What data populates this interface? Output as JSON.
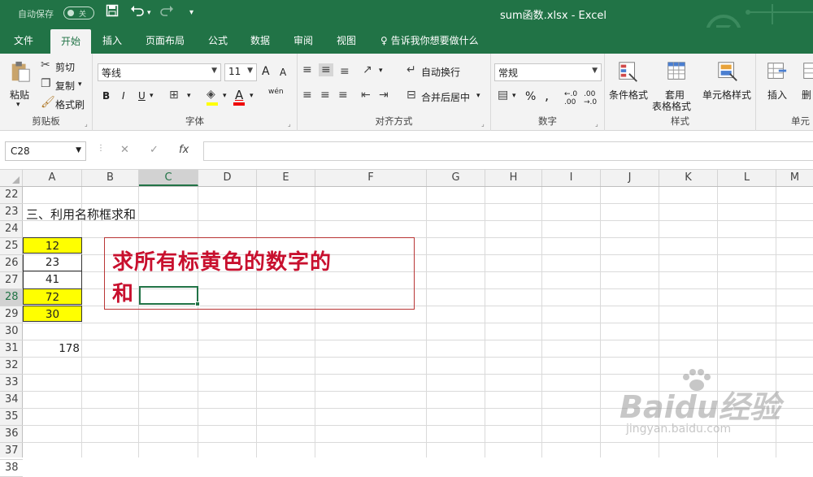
{
  "titlebar": {
    "autosave_label": "自动保存",
    "autosave_state": "关",
    "window_title": "sum函数.xlsx  -  Excel"
  },
  "tabs": [
    {
      "label": "文件"
    },
    {
      "label": "开始"
    },
    {
      "label": "插入"
    },
    {
      "label": "页面布局"
    },
    {
      "label": "公式"
    },
    {
      "label": "数据"
    },
    {
      "label": "审阅"
    },
    {
      "label": "视图"
    }
  ],
  "tell_me": "告诉我你想要做什么",
  "ribbon": {
    "clipboard": {
      "paste": "粘贴",
      "cut": "剪切",
      "copy": "复制",
      "format_painter": "格式刷",
      "label": "剪贴板"
    },
    "font": {
      "font_name": "等线",
      "font_size": "11",
      "label": "字体",
      "grow": "A",
      "shrink": "A",
      "bold": "B",
      "italic": "I",
      "underline": "U",
      "phonetic": "wén"
    },
    "alignment": {
      "wrap": "自动换行",
      "merge": "合并后居中",
      "label": "对齐方式"
    },
    "number": {
      "format": "常规",
      "label": "数字",
      "percent": "%",
      "comma": ","
    },
    "styles": {
      "conditional": "条件格式",
      "table1": "套用",
      "table2": "表格格式",
      "cell_styles": "单元格样式",
      "label": "样式"
    },
    "cells": {
      "insert": "插入",
      "delete": "删",
      "label": "单元"
    }
  },
  "formula_bar": {
    "name_box": "C28",
    "cancel": "✕",
    "enter": "✓",
    "fx": "fx",
    "formula": ""
  },
  "columns": [
    "A",
    "B",
    "C",
    "D",
    "E",
    "F",
    "G",
    "H",
    "I",
    "J",
    "K",
    "L",
    "M"
  ],
  "rows": [
    "22",
    "23",
    "24",
    "25",
    "26",
    "27",
    "28",
    "29",
    "30",
    "31",
    "32",
    "33",
    "34",
    "35",
    "36",
    "37",
    "38"
  ],
  "cells": {
    "A23": "三、利用名称框求和",
    "A25": "12",
    "A26": "23",
    "A27": "41",
    "A28": "72",
    "A29": "30",
    "A31": "178"
  },
  "highlight_color": "#ffff00",
  "textbox": {
    "line1": "求所有标黄色的数字的",
    "line2": "和"
  },
  "watermark": {
    "brand": "Baidu经验",
    "url": "jingyan.baidu.com"
  }
}
